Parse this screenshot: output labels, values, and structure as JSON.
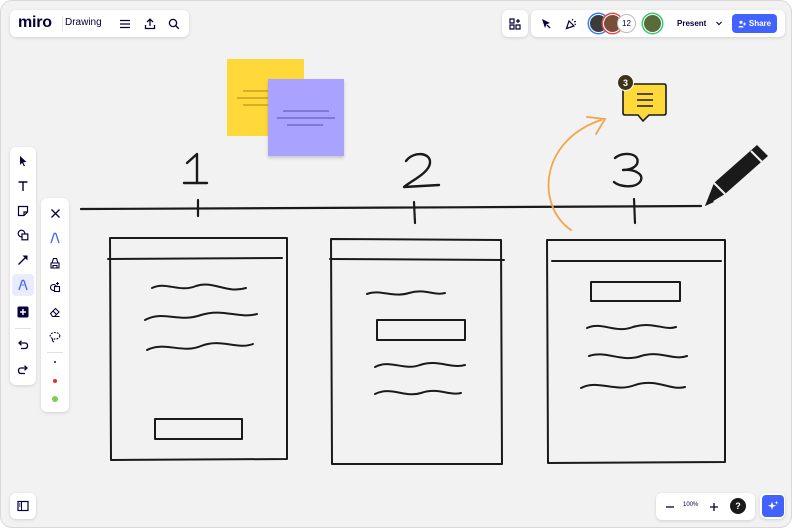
{
  "app": {
    "logo": "miro",
    "board_title": "Drawing"
  },
  "header": {
    "collaborator_count": "12",
    "present_label": "Present",
    "share_label": "Share",
    "colors": {
      "share": "#4262ff",
      "avatar_ring": "#e34b4b"
    }
  },
  "left_toolbar": {
    "items": [
      "select-icon",
      "text-icon",
      "sticky-note-icon",
      "shapes-icon",
      "connector-arrow-icon",
      "pen-icon",
      "add-icon",
      "undo-icon",
      "redo-icon"
    ],
    "active": "pen-icon"
  },
  "pen_panel": {
    "items": [
      "close-icon",
      "pen-icon",
      "highlighter-icon",
      "smart-drawing-icon",
      "eraser-icon",
      "lasso-icon"
    ],
    "colors": [
      "#1a1a1a",
      "#e5332a",
      "#7ccf4a"
    ]
  },
  "canvas": {
    "step_labels": [
      "1",
      "2",
      "3"
    ],
    "comment_count": "3",
    "sticky_colors": [
      "#ffd83a",
      "#a9a3ff"
    ],
    "arrow_color": "#f2a54a"
  },
  "zoom": {
    "level": "100%"
  }
}
